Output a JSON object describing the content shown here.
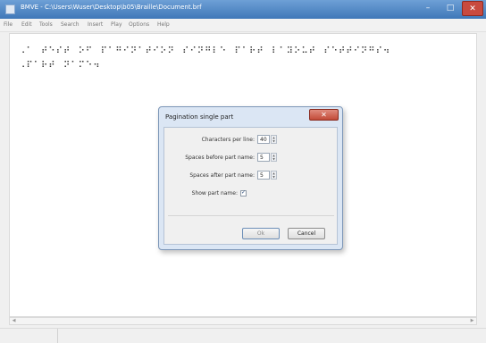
{
  "window": {
    "title": "BMVE - C:\\Users\\Wuser\\Desktop\\b05\\Braille\\Document.brf",
    "controls": {
      "minimize": "–",
      "maximize": "□",
      "close": "✕"
    }
  },
  "menu": [
    "File",
    "Edit",
    "Tools",
    "Search",
    "Insert",
    "Play",
    "Options",
    "Help"
  ],
  "editor": {
    "lines": [
      "⠠⠁⠀⠞⠑⠎⠞⠀⠕⠋⠀⠏⠁⠛⠊⠝⠁⠞⠊⠕⠝⠀⠎⠊⠝⠛⠇⠑⠀⠏⠁⠗⠞⠀⠇⠁⠽⠕⠥⠞⠀⠎⠑⠞⠞⠊⠝⠛⠎⠲",
      "⠠⠏⠁⠗⠞⠀⠝⠁⠍⠑⠲"
    ]
  },
  "dialog": {
    "title": "Pagination single part",
    "close": "✕",
    "fields": [
      {
        "label": "Characters per line:",
        "value": "40"
      },
      {
        "label": "Spaces before part name:",
        "value": "5"
      },
      {
        "label": "Spaces after part name:",
        "value": "5"
      }
    ],
    "show_part_name": {
      "label": "Show part name:",
      "checked": true,
      "mark": "✓"
    },
    "buttons": {
      "ok": "Ok",
      "cancel": "Cancel"
    }
  },
  "scroll_arrows": {
    "left": "◀",
    "right": "▶",
    "up": "▲",
    "down": "▼"
  }
}
